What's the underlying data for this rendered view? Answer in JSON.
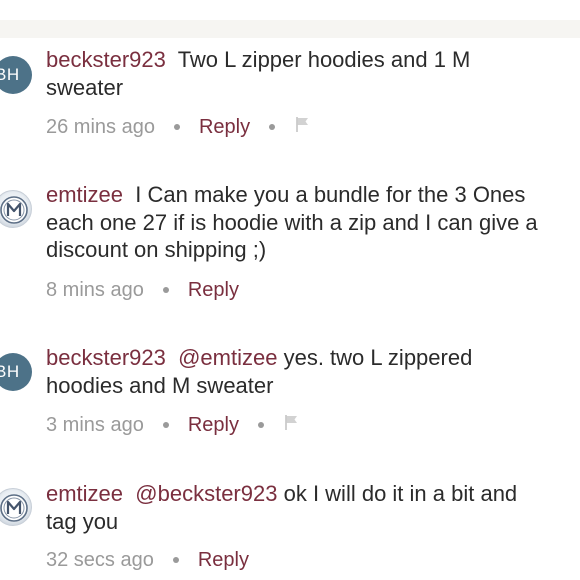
{
  "comments": [
    {
      "avatar": {
        "type": "initials",
        "initials": "BH",
        "color": "#4d7288"
      },
      "username": "beckster923",
      "mention": "",
      "line1": "Two L zipper hoodies and 1 M",
      "line2": "sweater",
      "line3": "",
      "time": "26 mins ago",
      "reply_label": "Reply",
      "has_flag": true
    },
    {
      "avatar": {
        "type": "logo",
        "icon": "m-badge-icon"
      },
      "username": "emtizee",
      "mention": "",
      "line1": "I Can make you a bundle for the 3 Ones",
      "line2": "each one 27 if is hoodie with a zip and I can give a",
      "line3": "discount on shipping ;)",
      "time": "8 mins ago",
      "reply_label": "Reply",
      "has_flag": false
    },
    {
      "avatar": {
        "type": "initials",
        "initials": "BH",
        "color": "#4d7288"
      },
      "username": "beckster923",
      "mention": "@emtizee",
      "line1": "yes.  two L zippered",
      "line2": "hoodies and M sweater",
      "line3": "",
      "time": "3 mins ago",
      "reply_label": "Reply",
      "has_flag": true
    },
    {
      "avatar": {
        "type": "logo",
        "icon": "m-badge-icon"
      },
      "username": "emtizee",
      "mention": "@beckster923",
      "line1": "ok I will do it in a bit and",
      "line2": "tag you",
      "line3": "",
      "time": "32 secs ago",
      "reply_label": "Reply",
      "has_flag": false
    }
  ],
  "colors": {
    "username": "#7a2f3f",
    "meta": "#9a9a9a",
    "text": "#2b2b2b",
    "avatar_bg": "#4d7288"
  }
}
